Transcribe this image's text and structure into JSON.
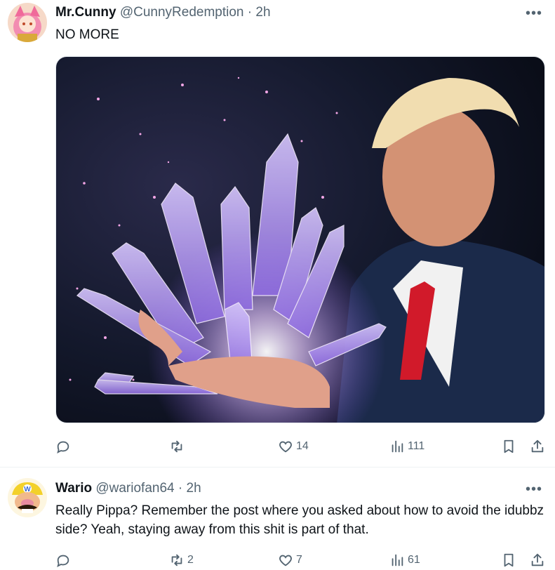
{
  "tweets": [
    {
      "name": "Mr.Cunny",
      "handle": "@CunnyRedemption",
      "separator": "·",
      "time": "2h",
      "text": "NO MORE",
      "has_media": true,
      "actions": {
        "replies": "",
        "retweets": "",
        "likes": "14",
        "views": "111"
      }
    },
    {
      "name": "Wario",
      "handle": "@wariofan64",
      "separator": "·",
      "time": "2h",
      "text": "Really Pippa? Remember the post where you asked about how to avoid the idubbz side? Yeah, staying away from this shit is part of that.",
      "has_media": false,
      "actions": {
        "replies": "",
        "retweets": "2",
        "likes": "7",
        "views": "61"
      }
    }
  ],
  "icons": {
    "reply": "reply-icon",
    "retweet": "retweet-icon",
    "like": "heart-icon",
    "views": "views-chart-icon",
    "bookmark": "bookmark-icon",
    "share": "share-icon",
    "more": "more-dots-icon"
  },
  "colors": {
    "text": "#0f1419",
    "secondary": "#536471",
    "divider": "#eff3f4"
  }
}
